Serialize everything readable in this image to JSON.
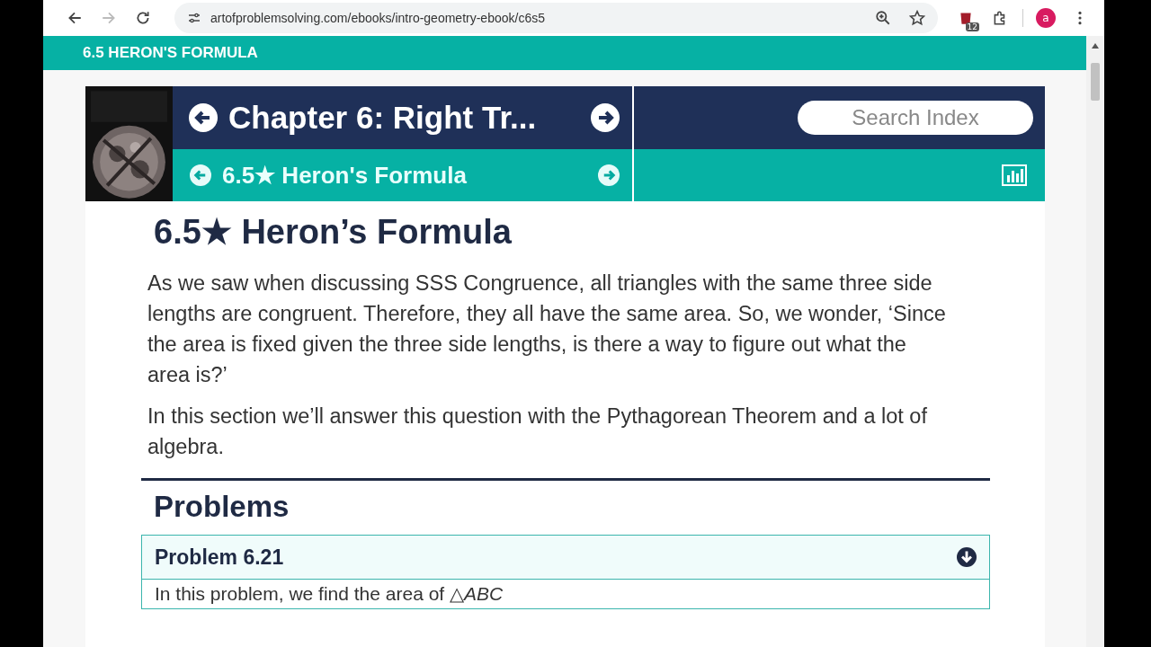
{
  "browser": {
    "url": "artofproblemsolving.com/ebooks/intro-geometry-ebook/c6s5",
    "extension_badge": "12",
    "profile_initial": "a"
  },
  "sticky_header": "6.5 HERON'S FORMULA",
  "nav": {
    "chapter": "Chapter 6: Right Tr...",
    "section": "6.5★ Heron's Formula",
    "search": {
      "placeholder": "Search Index"
    }
  },
  "title": "6.5★ Heron’s Formula",
  "paragraphs": [
    "As we saw when discussing SSS Congruence, all triangles with the same three side lengths are congruent. Therefore, they all have the same area. So, we wonder, ‘Since the area is fixed given the three side lengths, is there a way to figure out what the area is?’",
    "In this section we’ll answer this question with the Pythagorean Theorem and a lot of algebra."
  ],
  "problems_heading": "Problems",
  "problems": [
    {
      "title": "Problem 6.21",
      "text": "In this problem, we find the area of △*ABC*"
    }
  ]
}
